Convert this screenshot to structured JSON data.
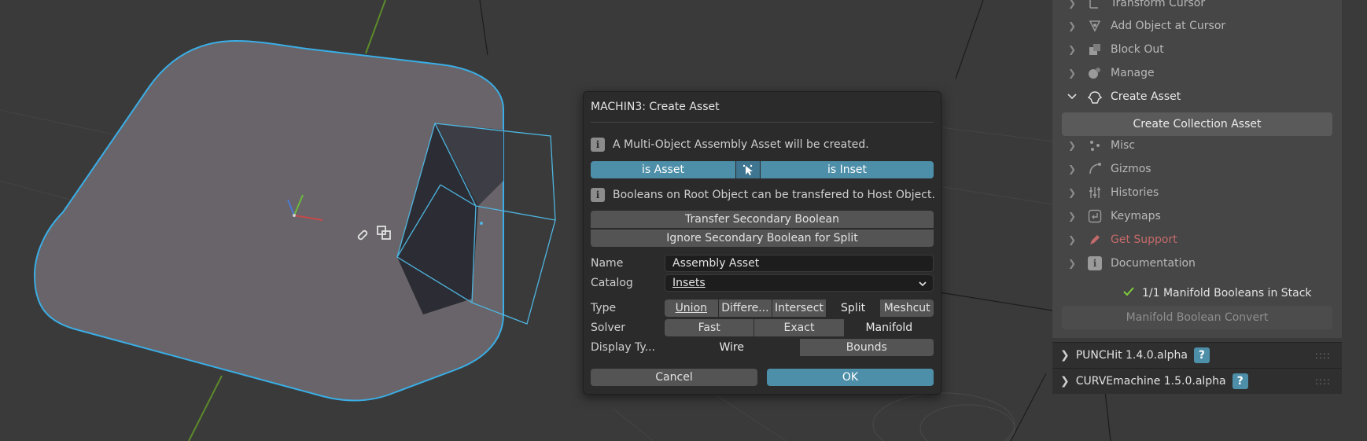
{
  "dialog": {
    "title": "MACHIN3: Create Asset",
    "info1": "A Multi-Object Assembly Asset will be created.",
    "toggle": {
      "left": "is Asset",
      "right": "is Inset"
    },
    "info2": "Booleans on Root Object can be transfered to Host Object.",
    "btn_transfer": "Transfer Secondary Boolean",
    "btn_ignore": "Ignore Secondary Boolean for Split",
    "name_label": "Name",
    "name_value": "Assembly Asset",
    "catalog_label": "Catalog",
    "catalog_value": "Insets",
    "type_label": "Type",
    "type_options": [
      "Union",
      "Differe...",
      "Intersect",
      "Split",
      "Meshcut"
    ],
    "type_selected": "Split",
    "solver_label": "Solver",
    "solver_options": [
      "Fast",
      "Exact",
      "Manifold"
    ],
    "solver_selected": "Manifold",
    "display_label": "Display Ty...",
    "display_options": [
      "Wire",
      "Bounds"
    ],
    "display_selected": "Wire",
    "cancel": "Cancel",
    "ok": "OK"
  },
  "sidebar": {
    "items": [
      {
        "label": "Transform Cursor",
        "icon": "transform-cursor-icon"
      },
      {
        "label": "Add Object at Cursor",
        "icon": "add-object-icon"
      },
      {
        "label": "Block Out",
        "icon": "block-out-icon"
      },
      {
        "label": "Manage",
        "icon": "manage-icon"
      },
      {
        "label": "Create Asset",
        "icon": "create-asset-icon"
      },
      {
        "label": "Misc",
        "icon": "misc-icon"
      },
      {
        "label": "Gizmos",
        "icon": "gizmos-icon"
      },
      {
        "label": "Histories",
        "icon": "histories-icon"
      },
      {
        "label": "Keymaps",
        "icon": "keymaps-icon"
      },
      {
        "label": "Get Support",
        "icon": "support-icon"
      },
      {
        "label": "Documentation",
        "icon": "documentation-icon"
      }
    ],
    "create_collection_btn": "Create Collection Asset",
    "manifold_status": "1/1 Manifold Booleans in Stack",
    "manifold_btn": "Manifold Boolean Convert",
    "support_color": "#c46a6a"
  },
  "addons": [
    {
      "label": "PUNCHit 1.4.0.alpha"
    },
    {
      "label": "CURVEmachine 1.5.0.alpha"
    }
  ],
  "colors": {
    "accent": "#4d8ea8",
    "selection_outline": "#3aaee6"
  }
}
